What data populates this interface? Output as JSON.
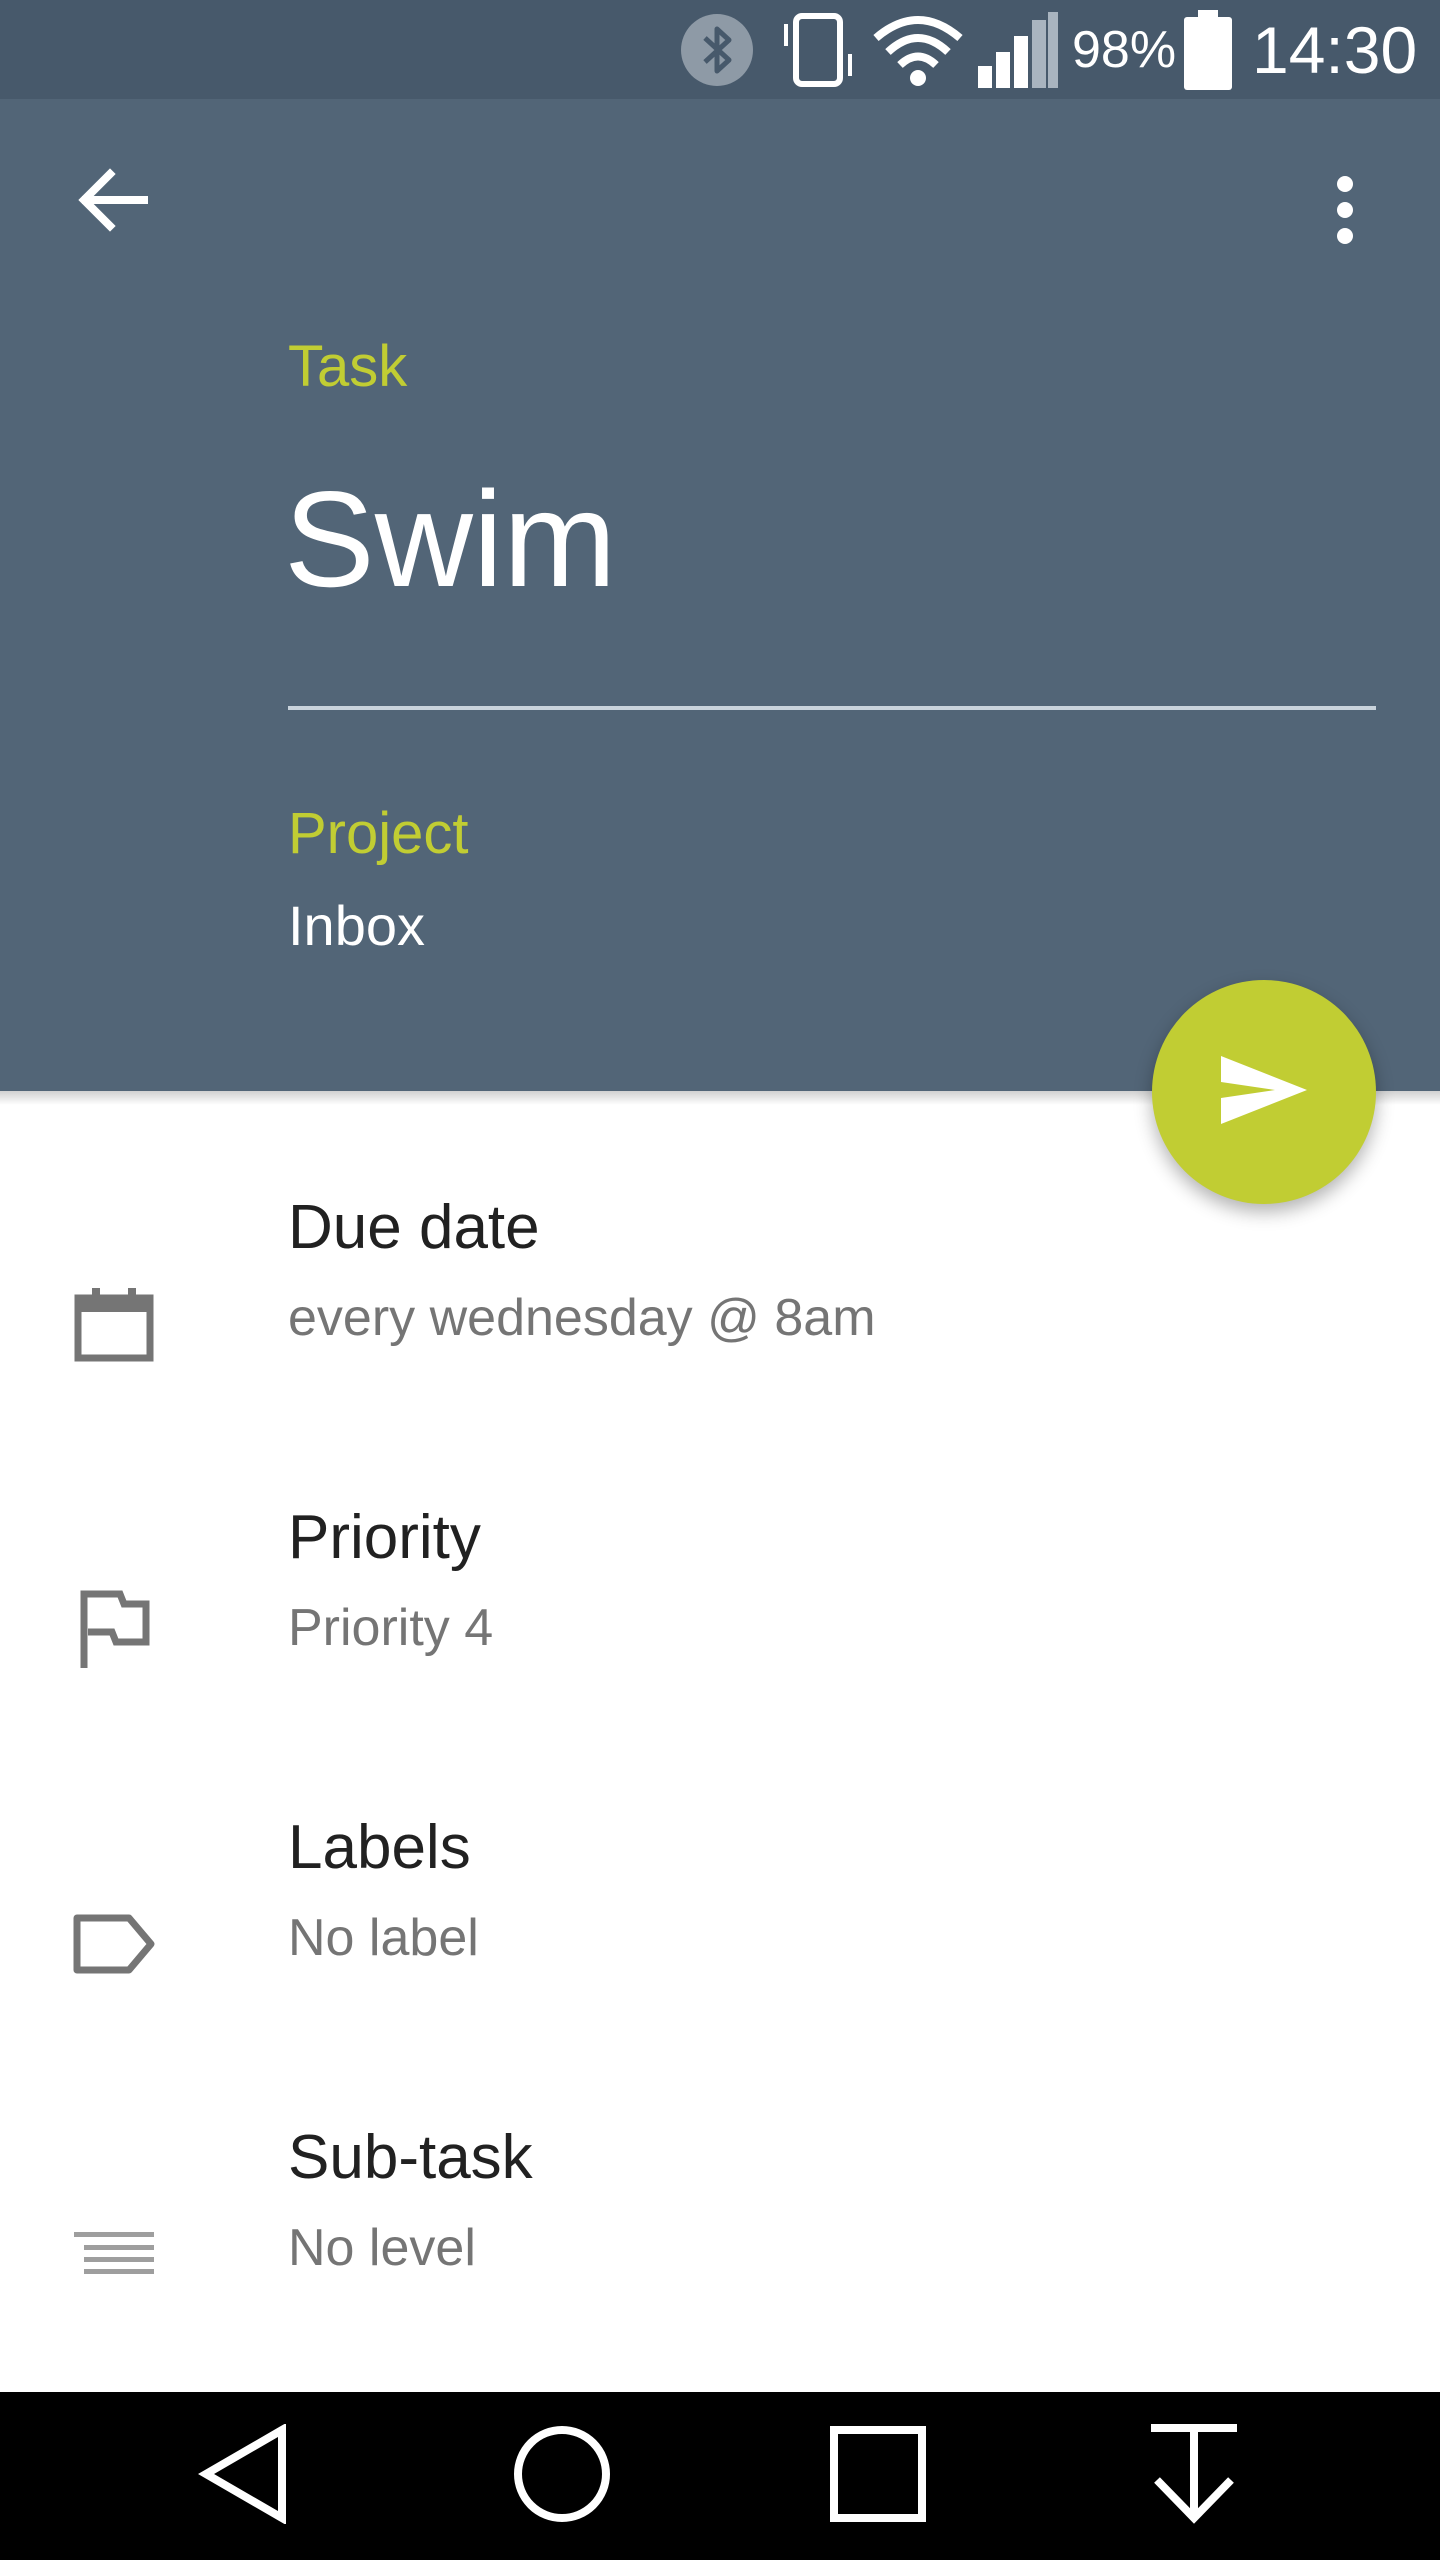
{
  "status_bar": {
    "battery_percent": "98%",
    "time": "14:30",
    "icons": [
      "bluetooth-icon",
      "vibrate-icon",
      "wifi-icon",
      "signal-icon",
      "battery-icon"
    ]
  },
  "header": {
    "back_icon": "arrow-left-icon",
    "more_icon": "more-vert-icon",
    "task_label": "Task",
    "task_name": "Swim",
    "project_label": "Project",
    "project_value": "Inbox",
    "fab_icon": "send-icon"
  },
  "rows": [
    {
      "icon": "calendar-icon",
      "title": "Due date",
      "subtitle": "every wednesday @ 8am"
    },
    {
      "icon": "flag-icon",
      "title": "Priority",
      "subtitle": "Priority 4"
    },
    {
      "icon": "label-icon",
      "title": "Labels",
      "subtitle": "No label"
    },
    {
      "icon": "subtask-icon",
      "title": "Sub-task",
      "subtitle": "No level"
    }
  ],
  "nav_bar": {
    "icons": [
      "nav-back-icon",
      "nav-home-icon",
      "nav-recents-icon",
      "nav-download-icon"
    ]
  },
  "colors": {
    "header_bg": "#526577",
    "status_bg": "#47596b",
    "accent": "#c1cd33",
    "icon_gray": "#757575"
  }
}
